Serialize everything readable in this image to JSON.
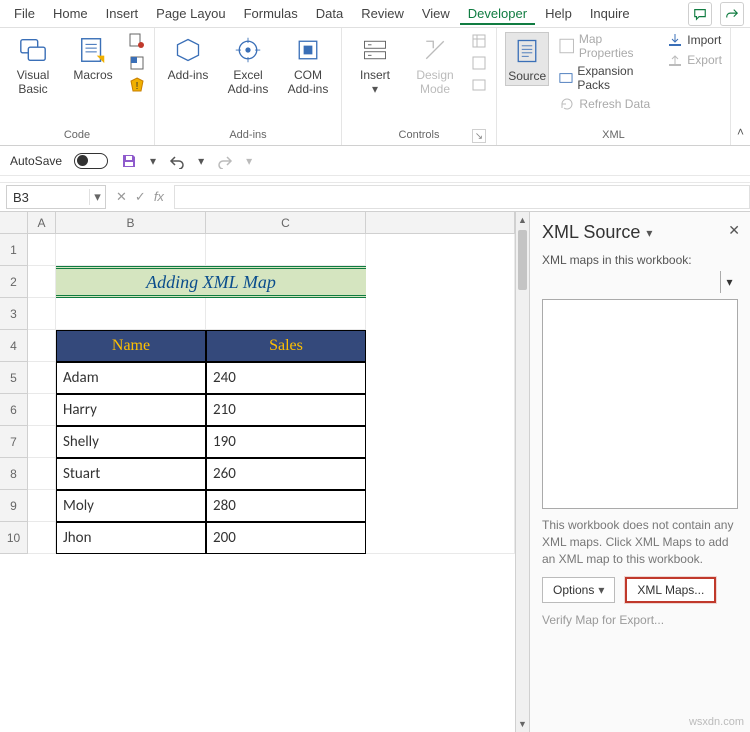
{
  "menu": {
    "items": [
      "File",
      "Home",
      "Insert",
      "Page Layou",
      "Formulas",
      "Data",
      "Review",
      "View",
      "Developer",
      "Help",
      "Inquire"
    ],
    "active_index": 8
  },
  "ribbon": {
    "groups": {
      "code": {
        "label": "Code",
        "visual_basic": "Visual Basic",
        "macros": "Macros"
      },
      "addins": {
        "label": "Add-ins",
        "addins": "Add-ins",
        "excel_addins": "Excel Add-ins",
        "com_addins": "COM Add-ins"
      },
      "controls": {
        "label": "Controls",
        "insert": "Insert",
        "design_mode": "Design Mode"
      },
      "xml": {
        "label": "XML",
        "source": "Source",
        "map_properties": "Map Properties",
        "expansion_packs": "Expansion Packs",
        "refresh_data": "Refresh Data",
        "import": "Import",
        "export": "Export"
      }
    }
  },
  "qat": {
    "autosave_label": "AutoSave",
    "autosave_state": "Off"
  },
  "namebox": "B3",
  "sheet": {
    "columns": [
      "A",
      "B",
      "C"
    ],
    "rows": [
      1,
      2,
      3,
      4,
      5,
      6,
      7,
      8,
      9,
      10
    ],
    "title": "Adding XML Map",
    "headers": {
      "name": "Name",
      "sales": "Sales"
    },
    "data": [
      {
        "name": "Adam",
        "sales": "240"
      },
      {
        "name": "Harry",
        "sales": "210"
      },
      {
        "name": "Shelly",
        "sales": "190"
      },
      {
        "name": "Stuart",
        "sales": "260"
      },
      {
        "name": "Moly",
        "sales": "280"
      },
      {
        "name": "Jhon",
        "sales": "200"
      }
    ]
  },
  "pane": {
    "title": "XML Source",
    "maps_label": "XML maps in this workbook:",
    "message": "This workbook does not contain any XML maps. Click XML Maps to add an XML map to this workbook.",
    "options_btn": "Options",
    "xml_maps_btn": "XML Maps...",
    "verify_link": "Verify Map for Export..."
  },
  "watermark": "wsxdn.com"
}
